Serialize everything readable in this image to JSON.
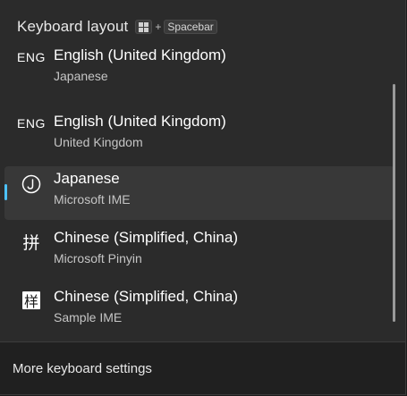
{
  "header": {
    "title": "Keyboard layout",
    "shortcut_plus": "+",
    "shortcut_key": "Spacebar",
    "shortcut_icon": "windows-logo-icon"
  },
  "layouts": [
    {
      "code": "ENG",
      "icon": "eng-badge",
      "name": "English (United Kingdom)",
      "sub": "Japanese",
      "selected": false
    },
    {
      "code": "ENG",
      "icon": "eng-badge",
      "name": "English (United Kingdom)",
      "sub": "United Kingdom",
      "selected": false
    },
    {
      "code": "",
      "icon": "ime-circle-j-icon",
      "name": "Japanese",
      "sub": "Microsoft IME",
      "selected": true
    },
    {
      "code": "",
      "icon": "pinyin-glyph-icon",
      "glyph": "拼",
      "name": "Chinese (Simplified, China)",
      "sub": "Microsoft Pinyin",
      "selected": false
    },
    {
      "code": "",
      "icon": "sample-ime-glyph-icon",
      "glyph": "样",
      "name": "Chinese (Simplified, China)",
      "sub": "Sample IME",
      "selected": false
    }
  ],
  "footer": {
    "link_label": "More keyboard settings"
  },
  "colors": {
    "accent": "#4cc2ff",
    "background": "#2b2b2b",
    "selected": "#383838"
  }
}
